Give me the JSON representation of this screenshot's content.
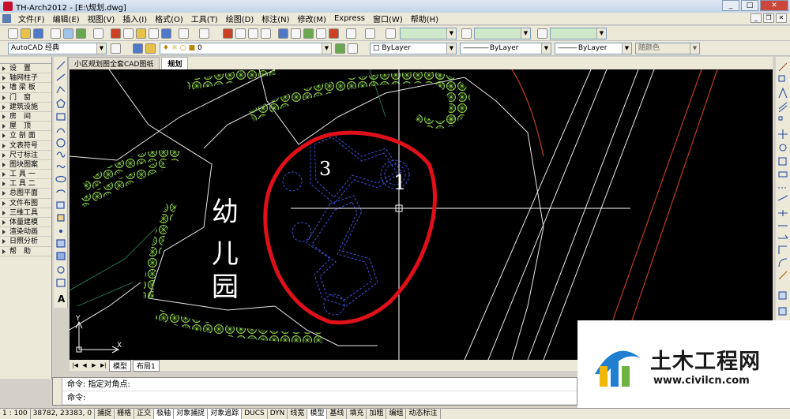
{
  "window": {
    "title": "TH-Arch2012 - [E:\\规划.dwg]"
  },
  "menubar": {
    "items": [
      "文件(F)",
      "编辑(E)",
      "视图(V)",
      "插入(I)",
      "格式(O)",
      "工具(T)",
      "绘图(D)",
      "标注(N)",
      "修改(M)",
      "Express",
      "窗口(W)",
      "帮助(H)"
    ]
  },
  "toolbar": {
    "workspace": "AutoCAD 经典",
    "layer": "0",
    "color": "ByLayer",
    "linetype": "ByLayer",
    "lineweight": "ByLayer",
    "plotstyle": "随颜色"
  },
  "tabs": [
    "小区规划图全套CAD图纸",
    "规划"
  ],
  "left_panel": {
    "items": [
      "设　置",
      "轴网柱子",
      "墙 梁 板",
      "门　窗",
      "建筑设施",
      "房　间",
      "屋　顶",
      "立 剖 面",
      "文表符号",
      "尺寸标注",
      "图块图案",
      "工 具 一",
      "工 具 二",
      "总图平面",
      "文件布图",
      "三维工具",
      "体量建模",
      "渲染动画",
      "日照分析",
      "帮　助"
    ]
  },
  "canvas": {
    "label_kindergarten": [
      "幼",
      "儿",
      "园"
    ],
    "mark_3": "3",
    "mark_1": "1",
    "ucs_x": "X",
    "ucs_y": "Y"
  },
  "layout_tabs": [
    "模型",
    "布局1"
  ],
  "command": {
    "line1": "命令: 指定对角点:",
    "line2": "命令:"
  },
  "statusbar": {
    "scale": "1 : 100",
    "coords": "38782, 23383, 0",
    "toggles": [
      "捕捉",
      "栅格",
      "正交",
      "极轴",
      "对象捕捉",
      "对象追踪",
      "DUCS",
      "DYN",
      "线宽",
      "模型",
      "基线",
      "填充",
      "加粗",
      "编组",
      "动态标注"
    ]
  },
  "watermark": {
    "title": "土木工程网",
    "url": "www.civilcn.com"
  },
  "colors": {
    "canvas_bg": "#000000",
    "markup_red": "#e0101a",
    "tree_green": "#8fd14f",
    "building_blue": "#3e4fd6"
  }
}
